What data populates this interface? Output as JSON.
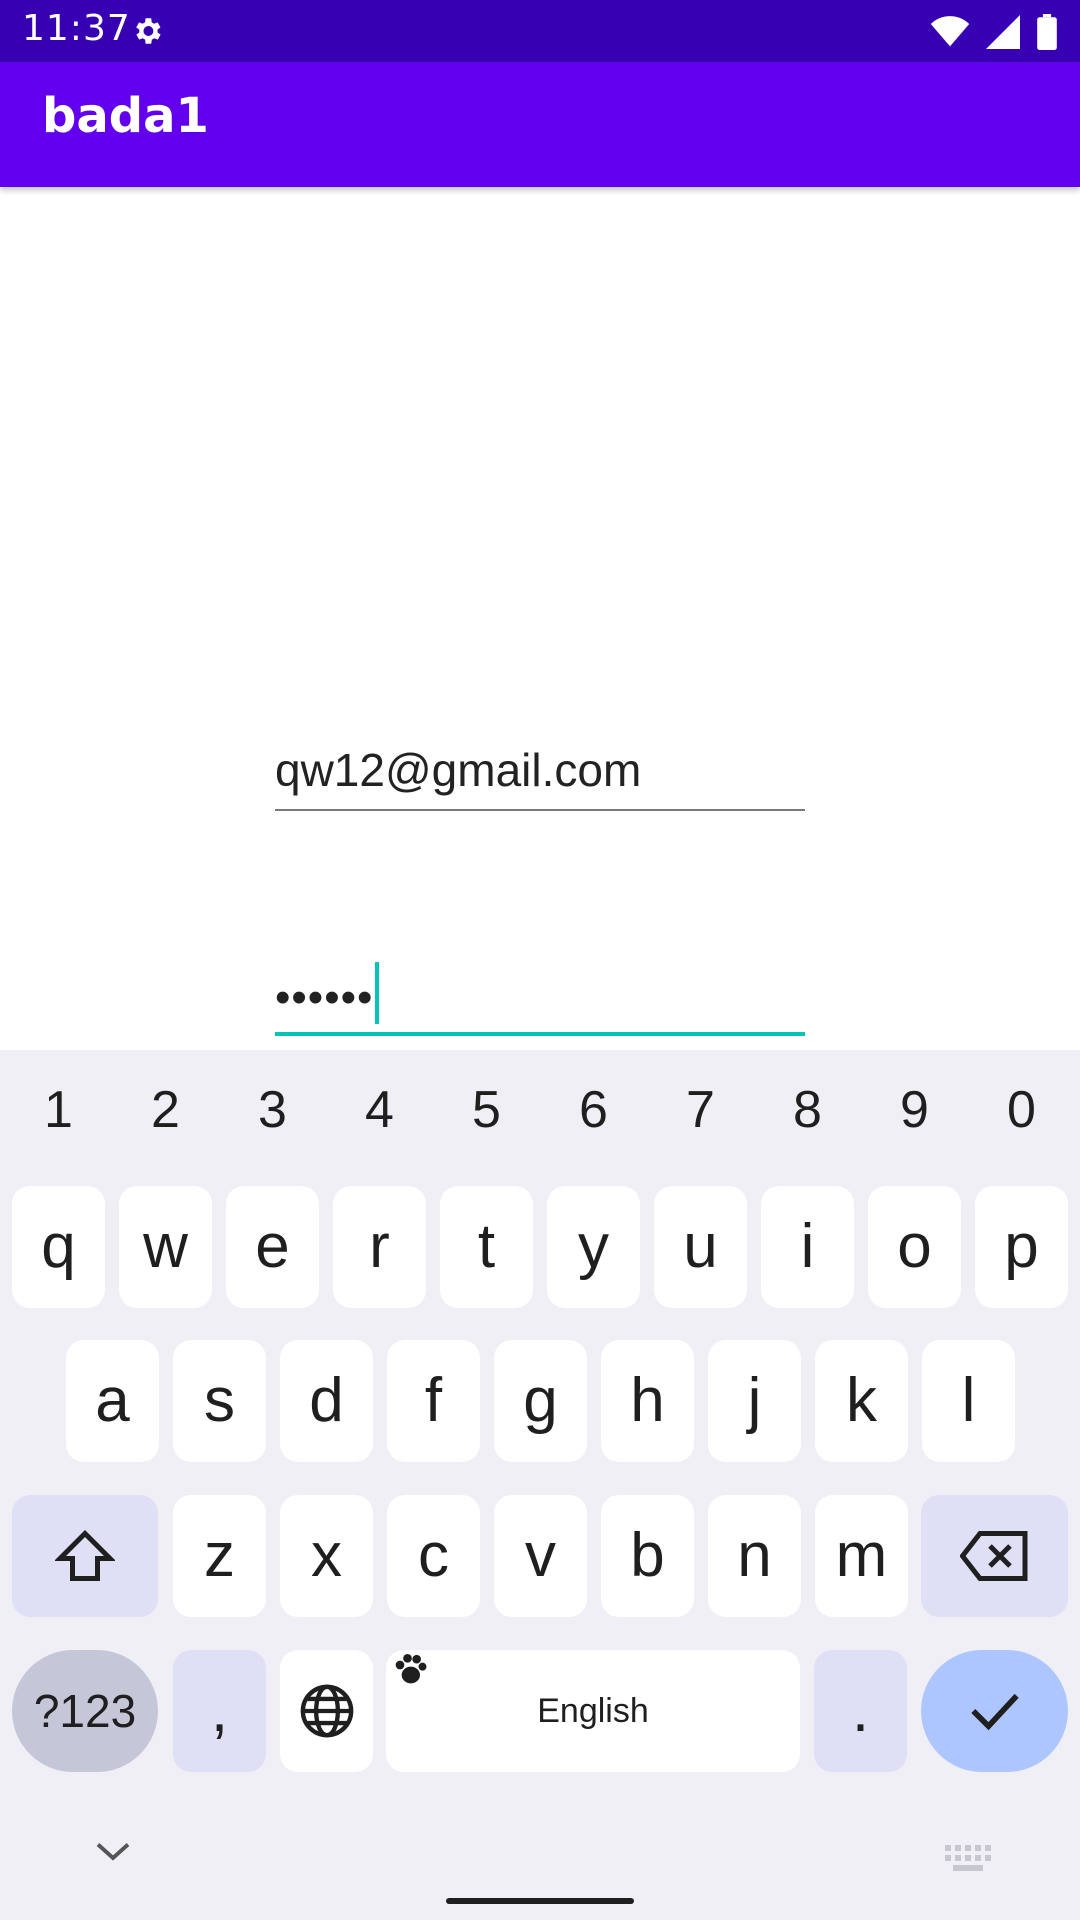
{
  "status_bar": {
    "time": "11:37"
  },
  "app_bar": {
    "title": "bada1"
  },
  "form": {
    "email_value": "qw12@gmail.com",
    "password_value": "••••••"
  },
  "keyboard": {
    "number_row": [
      "1",
      "2",
      "3",
      "4",
      "5",
      "6",
      "7",
      "8",
      "9",
      "0"
    ],
    "row1": [
      "q",
      "w",
      "e",
      "r",
      "t",
      "y",
      "u",
      "i",
      "o",
      "p"
    ],
    "row2": [
      "a",
      "s",
      "d",
      "f",
      "g",
      "h",
      "j",
      "k",
      "l"
    ],
    "row3": [
      "z",
      "x",
      "c",
      "v",
      "b",
      "n",
      "m"
    ],
    "symbols_label": "?123",
    "comma_label": ",",
    "period_label": ".",
    "space_label": "English"
  },
  "colors": {
    "status_bar": "#3700b3",
    "app_bar": "#6200ee",
    "accent": "#03c4b8"
  }
}
